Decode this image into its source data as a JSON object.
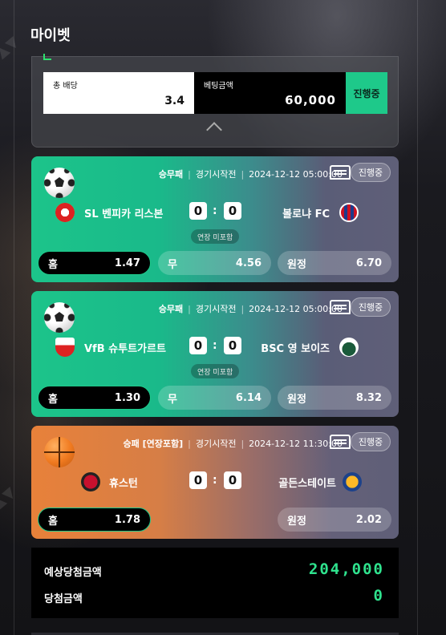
{
  "page": {
    "title": "마이벳"
  },
  "summary": {
    "peek_label": "",
    "total_odds_label": "총 배당",
    "total_odds_value": "3.4",
    "bet_amount_label": "베팅금액",
    "bet_amount_value": "60,000",
    "status_button": "진행중"
  },
  "matches": [
    {
      "sport": "soccer-icon",
      "market": "승무패",
      "state": "경기시작전",
      "datetime": "2024-12-12 05:00:00",
      "status": "진행중",
      "home_team": "SL 벤피카 리스본",
      "away_team": "볼로냐 FC",
      "home_score": "0",
      "away_score": "0",
      "extra_time": "연장 미포함",
      "odds": {
        "home_label": "홈",
        "home": "1.47",
        "draw_label": "무",
        "draw": "4.56",
        "away_label": "원정",
        "away": "6.70"
      }
    },
    {
      "sport": "soccer-icon",
      "market": "승무패",
      "state": "경기시작전",
      "datetime": "2024-12-12 05:00:00",
      "status": "진행중",
      "home_team": "VfB 슈투트가르트",
      "away_team": "BSC 영 보이즈",
      "home_score": "0",
      "away_score": "0",
      "extra_time": "연장 미포함",
      "odds": {
        "home_label": "홈",
        "home": "1.30",
        "draw_label": "무",
        "draw": "6.14",
        "away_label": "원정",
        "away": "8.32"
      }
    },
    {
      "sport": "basketball-icon",
      "market": "승패 [연장포함]",
      "state": "경기시작전",
      "datetime": "2024-12-12 11:30:00",
      "status": "진행중",
      "home_team": "휴스턴",
      "away_team": "골든스테이트",
      "home_score": "0",
      "away_score": "0",
      "odds": {
        "home_label": "홈",
        "home": "1.78",
        "away_label": "원정",
        "away": "2.02"
      }
    }
  ],
  "totals": {
    "expected_label": "예상당첨금액",
    "expected_value": "204,000",
    "won_label": "당첨금액",
    "won_value": "0"
  },
  "colors": {
    "accent_green": "#1ec98a",
    "soccer_card": "#1cc48a",
    "basket_card": "#e8813a",
    "win_text": "#2fe38e"
  }
}
